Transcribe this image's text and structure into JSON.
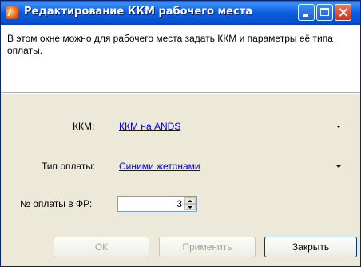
{
  "window": {
    "title": "Редактирование ККМ рабочего места"
  },
  "info": {
    "text": "В этом окне можно для рабочего места задать ККМ и параметры её типа оплаты."
  },
  "form": {
    "kkm_label": "ККМ:",
    "kkm_value": "ККМ на ANDS",
    "payment_type_label": "Тип оплаты:",
    "payment_type_value": "Синими жетонами",
    "fr_payment_no_label": "№ оплаты в ФР:",
    "fr_payment_no_value": "3"
  },
  "buttons": {
    "ok": "ОК",
    "apply": "Применить",
    "close": "Закрыть"
  },
  "colors": {
    "title_bar": "#0b5ee0",
    "link": "#0000e0",
    "dialog_bg": "#ece9d8"
  },
  "icons": {
    "app": "app-icon",
    "minimize": "minimize-icon",
    "maximize": "maximize-icon",
    "close": "close-icon",
    "dropdown": "chevron-down-icon"
  }
}
